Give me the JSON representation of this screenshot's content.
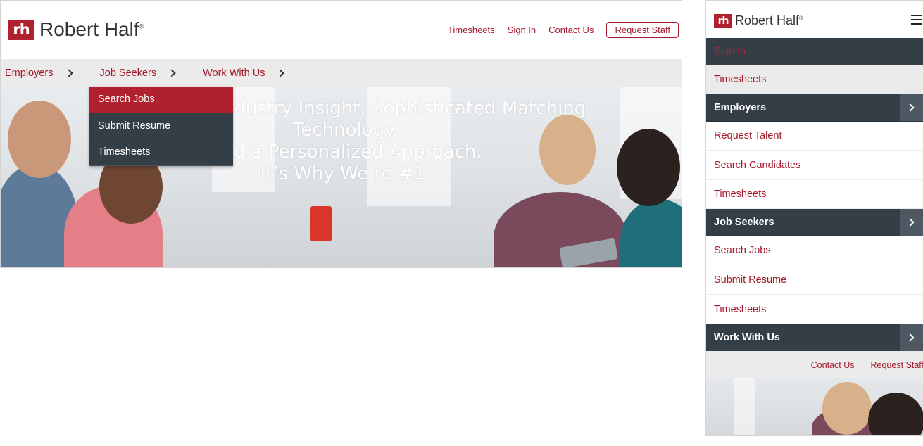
{
  "brand": {
    "logo_mark": "rh",
    "name": "Robert Half",
    "registered": "®",
    "accent": "#b1202f",
    "dark": "#343e47"
  },
  "desktop": {
    "util_links": [
      {
        "label": "Timesheets"
      },
      {
        "label": "Sign In"
      },
      {
        "label": "Contact Us"
      }
    ],
    "request_button": "Request Staff",
    "nav": [
      {
        "label": "Employers"
      },
      {
        "label": "Job Seekers"
      },
      {
        "label": "Work With Us"
      }
    ],
    "dropdown": [
      {
        "label": "Search Jobs",
        "active": true
      },
      {
        "label": "Submit Resume",
        "active": false
      },
      {
        "label": "Timesheets",
        "active": false
      }
    ],
    "hero_lines": [
      "Unmatched Industry Insight. Sophisticated Matching Technology.",
      "And a Personalized Approach.",
      "It’s Why We’re #1."
    ]
  },
  "mobile": {
    "menu_icon": "hamburger-icon",
    "sign_in": "Sign In",
    "timesheets_top": "Timesheets",
    "employers": {
      "label": "Employers",
      "items": [
        "Request Talent",
        "Search Candidates",
        "Timesheets"
      ]
    },
    "job_seekers": {
      "label": "Job Seekers",
      "items": [
        "Search Jobs",
        "Submit Resume",
        "Timesheets"
      ]
    },
    "work_with_us": {
      "label": "Work With Us"
    },
    "util_links": [
      {
        "label": "Contact Us"
      },
      {
        "label": "Request Staff"
      }
    ]
  }
}
